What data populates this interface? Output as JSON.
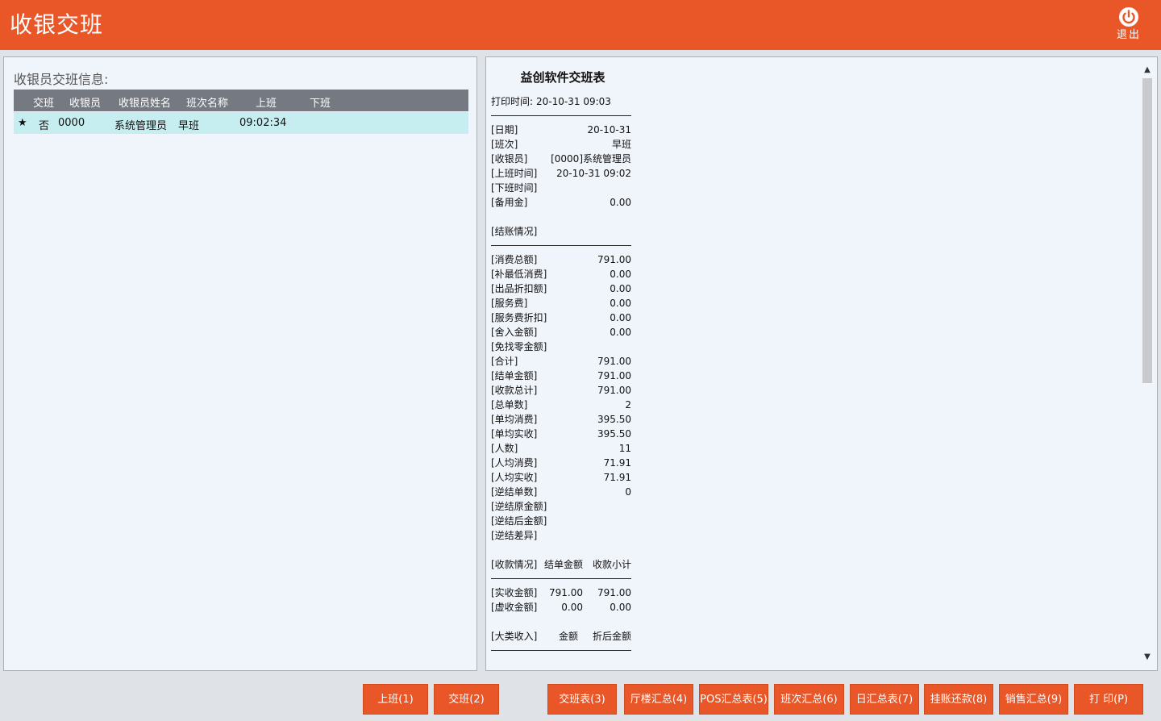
{
  "app": {
    "title": "收银交班",
    "exit_label": "退出"
  },
  "left": {
    "title": "收银员交班信息:",
    "columns": [
      "交班",
      "收银员",
      "收银员姓名",
      "班次名称",
      "上班",
      "下班"
    ],
    "rows": [
      {
        "marker": "★",
        "handover": "否",
        "cashier_id": "0000",
        "cashier_name": "系统管理员",
        "shift": "早班",
        "on_time": "09:02:34",
        "off_time": ""
      }
    ]
  },
  "receipt": {
    "title": "益创软件交班表",
    "print_time_label": "打印时间:",
    "print_time": "20-10-31 09:03",
    "info": [
      {
        "k": "[日期]",
        "v": "20-10-31"
      },
      {
        "k": "[班次]",
        "v": "早班"
      },
      {
        "k": "[收银员]",
        "v": "[0000]系统管理员"
      },
      {
        "k": "[上班时间]",
        "v": "20-10-31 09:02"
      },
      {
        "k": "[下班时间]",
        "v": ""
      },
      {
        "k": "[备用金]",
        "v": "0.00"
      }
    ],
    "settle_label": "[结账情况]",
    "settle": [
      {
        "k": "[消费总额]",
        "v": "791.00"
      },
      {
        "k": "[补最低消费]",
        "v": "0.00"
      },
      {
        "k": "[出品折扣额]",
        "v": "0.00"
      },
      {
        "k": "[服务费]",
        "v": "0.00"
      },
      {
        "k": "[服务费折扣]",
        "v": "0.00"
      },
      {
        "k": "[舍入金额]",
        "v": "0.00"
      },
      {
        "k": "[免找零金额]",
        "v": ""
      },
      {
        "k": "[合计]",
        "v": "791.00"
      },
      {
        "k": "[结单金额]",
        "v": "791.00"
      },
      {
        "k": "[收款总计]",
        "v": "791.00"
      },
      {
        "k": "[总单数]",
        "v": "2"
      },
      {
        "k": "[单均消费]",
        "v": "395.50"
      },
      {
        "k": "[单均实收]",
        "v": "395.50"
      },
      {
        "k": "[人数]",
        "v": "11"
      },
      {
        "k": "[人均消费]",
        "v": "71.91"
      },
      {
        "k": "[人均实收]",
        "v": "71.91"
      },
      {
        "k": "[逆结单数]",
        "v": "0"
      },
      {
        "k": "[逆结原金额]",
        "v": ""
      },
      {
        "k": "[逆结后金额]",
        "v": ""
      },
      {
        "k": "[逆结差异]",
        "v": ""
      }
    ],
    "pay_header": {
      "k": "[收款情况]",
      "c1": "结单金额",
      "c2": "收款小计"
    },
    "pay": [
      {
        "k": "[实收金额]",
        "c1": "791.00",
        "c2": "791.00"
      },
      {
        "k": "[虚收金额]",
        "c1": "0.00",
        "c2": "0.00"
      }
    ],
    "cat_header": {
      "k": "[大类收入]",
      "c1": "金额",
      "c2": "折后金额"
    }
  },
  "buttons": {
    "on_duty": "上班(1)",
    "handover": "交班(2)",
    "handover_report": "交班表(3)",
    "hall_summary": "厅楼汇总(4)",
    "pos_summary": "POS汇总表(5)",
    "shift_summary": "班次汇总(6)",
    "daily_summary": "日汇总表(7)",
    "credit_repay": "挂账还款(8)",
    "sales_summary": "销售汇总(9)",
    "print": "打 印(P)"
  }
}
